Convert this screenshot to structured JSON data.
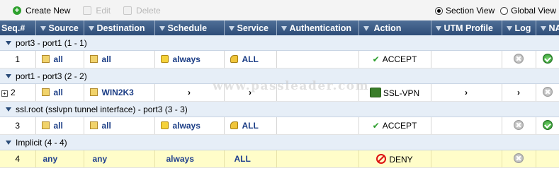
{
  "toolbar": {
    "create_new": "Create New",
    "edit": "Edit",
    "delete": "Delete",
    "section_view": "Section View",
    "global_view": "Global View"
  },
  "columns": [
    "Seq.#",
    "Source",
    "Destination",
    "Schedule",
    "Service",
    "Authentication",
    "Action",
    "UTM Profile",
    "Log",
    "NA"
  ],
  "sections": [
    {
      "title": "port3 - port1  (1 - 1)",
      "rows": [
        {
          "seq": "1",
          "source": "all",
          "destination": "all",
          "schedule": "always",
          "service": "ALL",
          "authentication": "",
          "action": "ACCEPT",
          "utm": "",
          "log": "disabled",
          "nat": "enabled"
        }
      ]
    },
    {
      "title": "port1 - port3  (2 - 2)",
      "rows": [
        {
          "seq": "2",
          "source": "all",
          "destination": "WIN2K3",
          "schedule": "›",
          "service": "›",
          "authentication": "",
          "action": "SSL-VPN",
          "utm": "›",
          "log": "›",
          "nat": "disabled"
        }
      ]
    },
    {
      "title": "ssl.root (sslvpn tunnel interface) - port3  (3 - 3)",
      "rows": [
        {
          "seq": "3",
          "source": "all",
          "destination": "all",
          "schedule": "always",
          "service": "ALL",
          "authentication": "",
          "action": "ACCEPT",
          "utm": "",
          "log": "disabled",
          "nat": "enabled"
        }
      ]
    },
    {
      "title": "Implicit  (4 - 4)",
      "rows": [
        {
          "seq": "4",
          "source": "any",
          "destination": "any",
          "schedule": "always",
          "service": "ALL",
          "authentication": "",
          "action": "DENY",
          "utm": "",
          "log": "disabled",
          "nat": ""
        }
      ]
    }
  ],
  "watermark": "www.passleader.com"
}
